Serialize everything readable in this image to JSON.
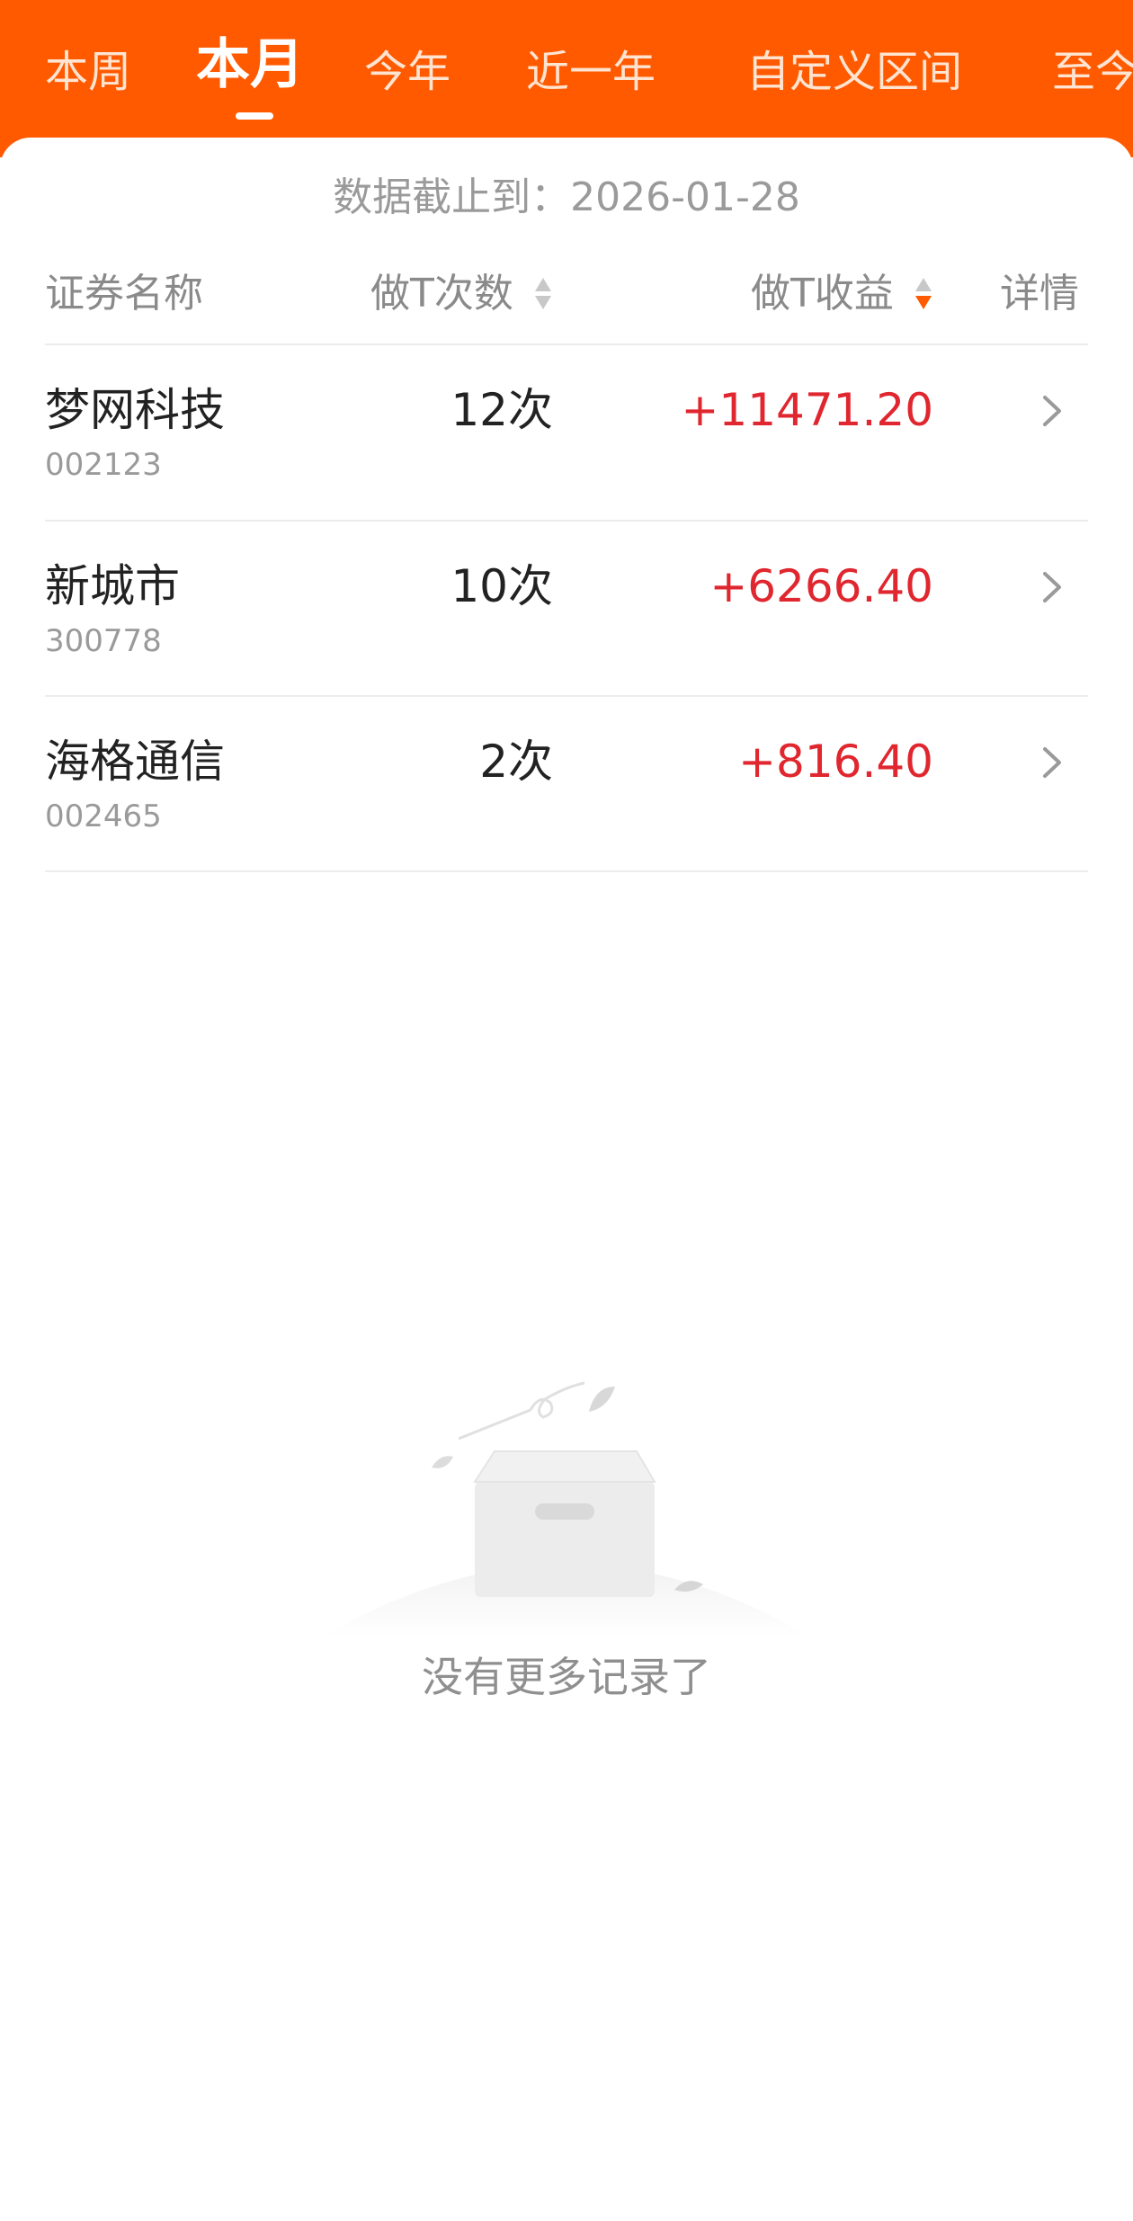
{
  "header": {
    "tabs": [
      {
        "label": "本周",
        "active": false
      },
      {
        "label": "本月",
        "active": true
      },
      {
        "label": "今年",
        "active": false
      },
      {
        "label": "近一年",
        "active": false
      },
      {
        "label": "自定义区间",
        "active": false
      },
      {
        "label": "至今",
        "active": false
      }
    ],
    "accent_color": "#ff5a00"
  },
  "asof": {
    "label": "数据截止到：",
    "date": "2026-01-28"
  },
  "table": {
    "columns": {
      "name": "证券名称",
      "count": "做T次数",
      "profit": "做T收益",
      "detail": "详情"
    },
    "sort": {
      "column": "profit",
      "direction": "desc"
    },
    "rows": [
      {
        "name": "梦网科技",
        "code": "002123",
        "count": "12次",
        "profit": "+11471.20"
      },
      {
        "name": "新城市",
        "code": "300778",
        "count": "10次",
        "profit": "+6266.40"
      },
      {
        "name": "海格通信",
        "code": "002465",
        "count": "2次",
        "profit": "+816.40"
      }
    ],
    "profit_color": "#e0262e"
  },
  "empty": {
    "text": "没有更多记录了",
    "icon": "empty-box-icon"
  }
}
